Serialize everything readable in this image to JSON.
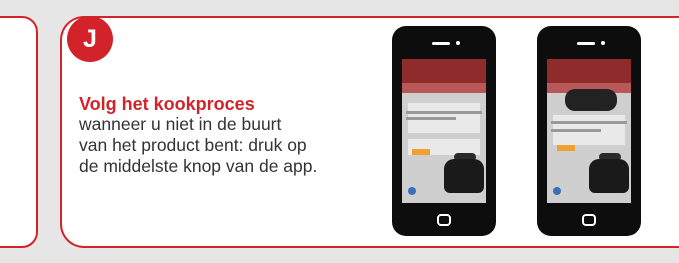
{
  "step": {
    "badge": "J"
  },
  "instruction": {
    "heading": "Volg het kookproces",
    "lines": [
      "wanneer u niet in de buurt",
      "van het product bent: druk op",
      "de middelste knop van de app."
    ]
  },
  "phones": [
    {
      "name": "phone-1",
      "icon": "smartphone-icon"
    },
    {
      "name": "phone-2",
      "icon": "smartphone-icon"
    }
  ],
  "colors": {
    "accent": "#d3232a",
    "text": "#333333",
    "background": "#e6e6e6"
  }
}
